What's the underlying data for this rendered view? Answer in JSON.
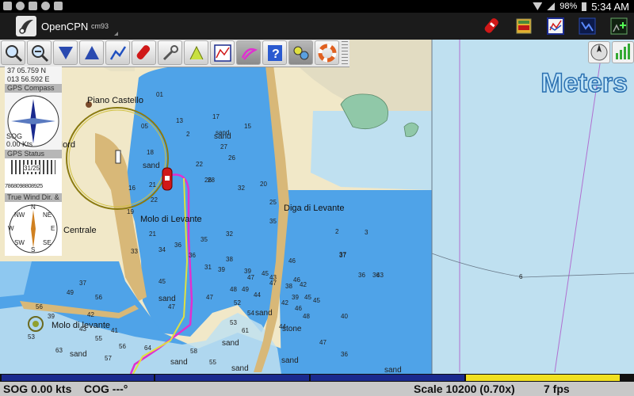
{
  "status_bar": {
    "battery": "98%",
    "time": "5:34 AM"
  },
  "app_bar": {
    "title": "OpenCPN",
    "subtitle": "cm93"
  },
  "units_label": "Meters",
  "dashboard": {
    "position": {
      "lat": "37 05.759 N",
      "lon": "013 56.592 E"
    },
    "gps_compass_caption": "GPS Compass",
    "gps_compass_values": [
      "SOG",
      "0.00 Kts"
    ],
    "gps_status_caption": "GPS Status",
    "gps_status_value": "31/25",
    "gps_status_numbers": "7868098808925",
    "true_wind_caption": "True Wind Dir. &",
    "wind_cardinals": [
      "N",
      "NE",
      "E",
      "SE",
      "S",
      "SW",
      "W",
      "NW"
    ]
  },
  "map": {
    "place_labels": [
      "Piano Castello",
      "a Nord",
      "Molo di Levante",
      "Diga di Levante",
      "Centrale",
      "Molo di levante"
    ],
    "seabed_labels": [
      "sand",
      "sand",
      "sand",
      "sand",
      "sand",
      "stone",
      "sand",
      "sand",
      "sand",
      "sand",
      "sand"
    ],
    "depths_main": [
      "01",
      "13",
      "17",
      "15",
      "05",
      "2",
      "18",
      "sand",
      "27",
      "22",
      "26",
      "16",
      "26",
      "21",
      "28",
      "32",
      "20",
      "19",
      "22",
      "25",
      "35",
      "33",
      "32",
      "21",
      "34",
      "35",
      "36",
      "38",
      "36",
      "31",
      "39",
      "39",
      "47",
      "43",
      "45",
      "49",
      "44",
      "47",
      "47",
      "46",
      "39",
      "42",
      "46",
      "48",
      "47",
      "42",
      "45",
      "45",
      "38",
      "45",
      "46",
      "37",
      "43",
      "40",
      "47",
      "44",
      "48",
      "36",
      "36"
    ],
    "depths_east": [
      "2",
      "3",
      "37",
      "36",
      "6"
    ],
    "depths_south": [
      "37",
      "49",
      "56",
      "56",
      "39",
      "42",
      "43",
      "41",
      "52",
      "54",
      "53",
      "61",
      "56",
      "55",
      "64",
      "58",
      "53",
      "63",
      "57",
      "55"
    ]
  },
  "footer": {
    "sog": "SOG 0.00 kts",
    "cog": "COG ---°",
    "scale": "Scale 10200 (0.70x)",
    "fps": "7 fps"
  },
  "colors": {
    "land": "#f1e8c8",
    "deep_water": "#bfe0f0",
    "shallow_water": "#4fa3e8",
    "medium_water": "#8ec8f0",
    "drying": "#90c8a8",
    "pier": "#d8b878",
    "chart_bar_blue": "#1a2a8e",
    "chart_bar_yellow": "#f0e020"
  }
}
